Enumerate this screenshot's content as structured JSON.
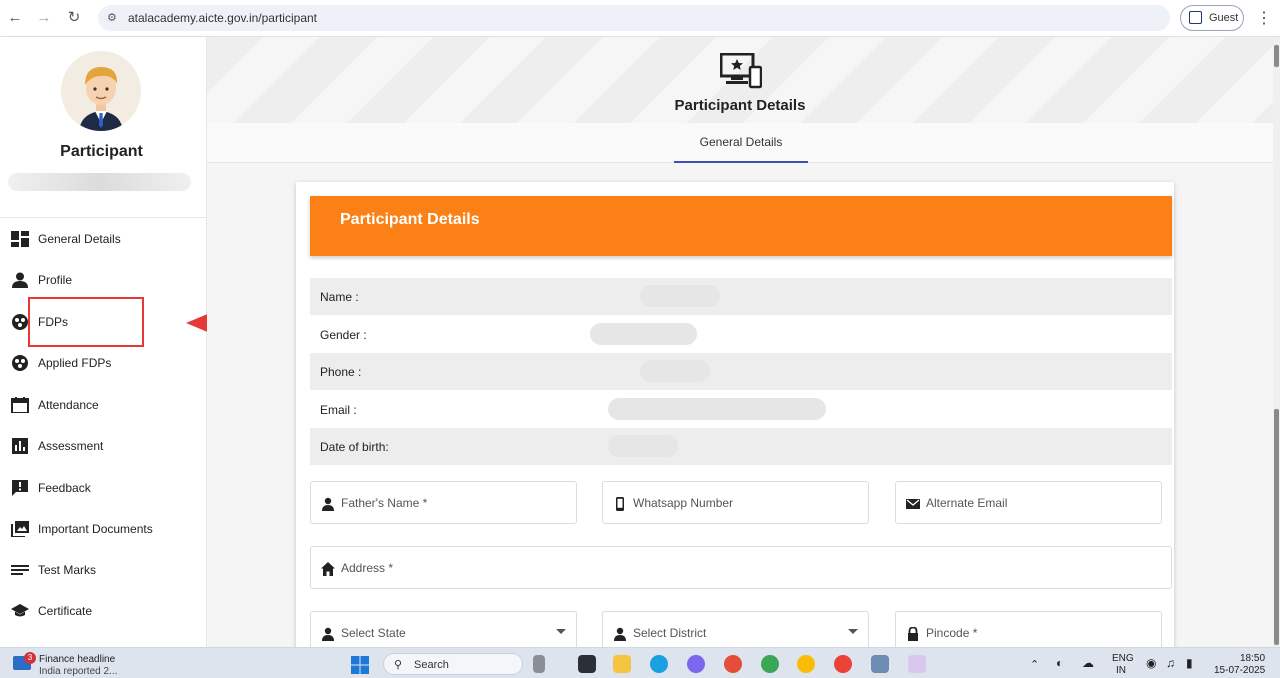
{
  "browser": {
    "url": "atalacademy.aicte.gov.in/participant",
    "profile_label": "Guest"
  },
  "sidebar": {
    "role": "Participant",
    "items": [
      {
        "label": "General Details",
        "icon": "dashboard-icon"
      },
      {
        "label": "Profile",
        "icon": "person-icon"
      },
      {
        "label": "FDPs",
        "icon": "group-icon"
      },
      {
        "label": "Applied FDPs",
        "icon": "group-icon"
      },
      {
        "label": "Attendance",
        "icon": "calendar-icon"
      },
      {
        "label": "Assessment",
        "icon": "bar-chart-icon"
      },
      {
        "label": "Feedback",
        "icon": "feedback-icon"
      },
      {
        "label": "Important Documents",
        "icon": "photo-library-icon"
      },
      {
        "label": "Test Marks",
        "icon": "notes-icon"
      },
      {
        "label": "Certificate",
        "icon": "graduation-cap-icon"
      }
    ]
  },
  "header": {
    "title": "Participant Details",
    "tab": "General Details"
  },
  "card": {
    "title": "Participant Details",
    "info_rows": [
      {
        "label": "Name :"
      },
      {
        "label": "Gender :"
      },
      {
        "label": "Phone :"
      },
      {
        "label": "Email :"
      },
      {
        "label": "Date of birth:"
      }
    ],
    "fields": {
      "fathers_name": "Father's Name *",
      "whatsapp": "Whatsapp Number",
      "alt_email": "Alternate Email",
      "address": "Address *",
      "state": "Select State",
      "district": "Select District",
      "pincode": "Pincode *"
    }
  },
  "taskbar": {
    "news_title": "Finance headline",
    "news_sub": "India reported 2...",
    "news_badge": "3",
    "search_label": "Search",
    "lang_1": "ENG",
    "lang_2": "IN",
    "time": "18:50",
    "date": "15-07-2025"
  },
  "colors": {
    "card_header": "#fb8015",
    "tab_underline": "#3f51b5",
    "annotation": "#e53935"
  }
}
